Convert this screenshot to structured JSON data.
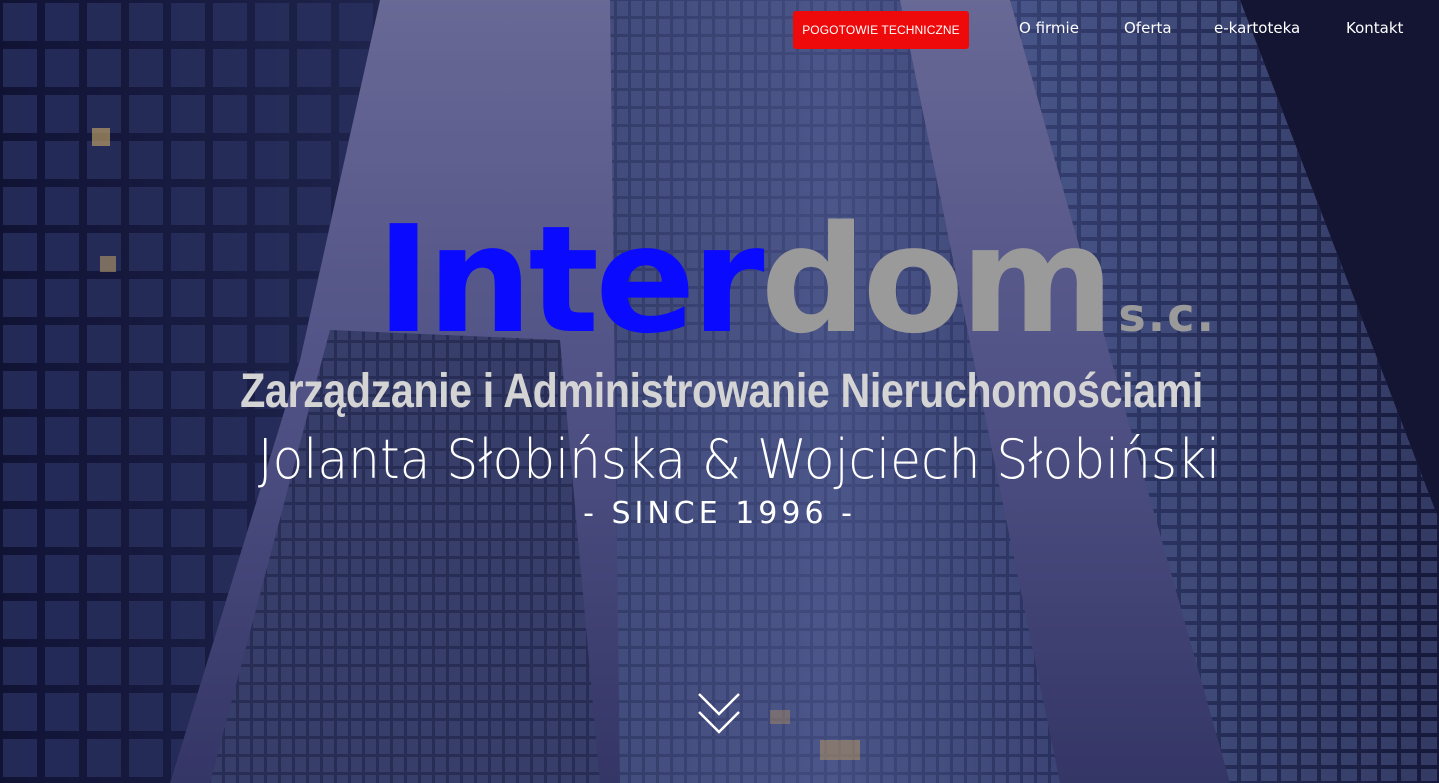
{
  "nav": {
    "emergency_label": "POGOTOWIE TECHNICZNE",
    "links": [
      "O firmie",
      "Oferta",
      "e-kartoteka",
      "Kontakt"
    ]
  },
  "logo": {
    "part_a": "Inter",
    "part_b": "dom",
    "suffix": "s.c.",
    "color_a": "#0a0aff",
    "color_b": "#9a9a9a"
  },
  "hero": {
    "tagline": "Zarządzanie i Administrowanie Nieruchomościami",
    "owners": "Jolanta Słobińska & Wojciech Słobiński",
    "since": "- SINCE 1996 -"
  },
  "icons": {
    "scroll": "chevron-down-icon"
  },
  "colors": {
    "emergency": "#ee0a0a",
    "text": "#ffffff"
  }
}
